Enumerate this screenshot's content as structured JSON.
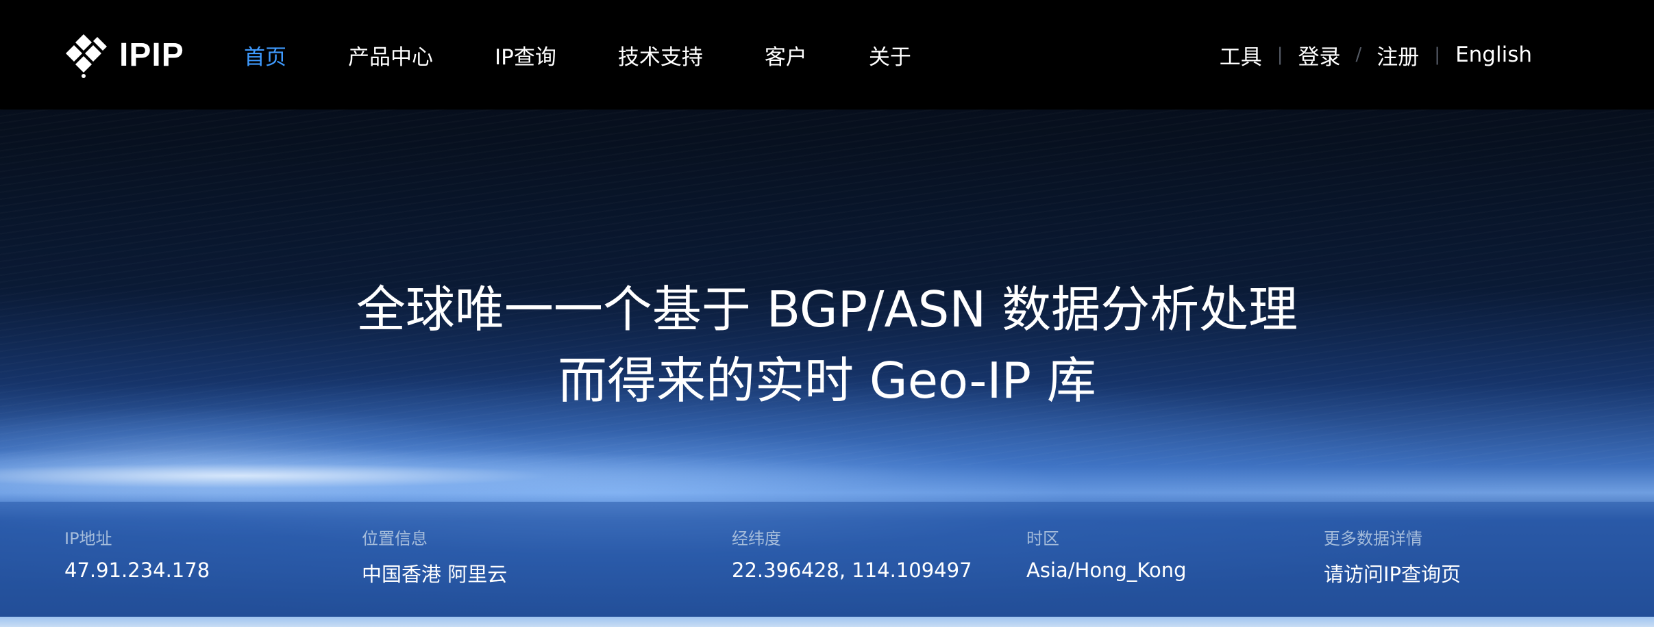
{
  "header": {
    "logo_text": "IPIP",
    "nav": [
      {
        "label": "首页",
        "active": true
      },
      {
        "label": "产品中心",
        "active": false
      },
      {
        "label": "IP查询",
        "active": false
      },
      {
        "label": "技术支持",
        "active": false
      },
      {
        "label": "客户",
        "active": false
      },
      {
        "label": "关于",
        "active": false
      }
    ],
    "right": {
      "tools": "工具",
      "login": "登录",
      "slash": "/",
      "register": "注册",
      "english": "English",
      "divider": "|"
    }
  },
  "hero": {
    "line1": "全球唯一一个基于 BGP/ASN 数据分析处理",
    "line2": "而得来的实时 Geo-IP 库"
  },
  "info": {
    "ip": {
      "label": "IP地址",
      "value": "47.91.234.178"
    },
    "location": {
      "label": "位置信息",
      "value": "中国香港 阿里云"
    },
    "coords": {
      "label": "经纬度",
      "value": "22.396428, 114.109497"
    },
    "timezone": {
      "label": "时区",
      "value": "Asia/Hong_Kong"
    },
    "more": {
      "label": "更多数据详情",
      "value": "请访问IP查询页"
    }
  },
  "colors": {
    "active_nav": "#3f9bff",
    "header_bg": "#000000",
    "info_label": "#a6bddb"
  }
}
